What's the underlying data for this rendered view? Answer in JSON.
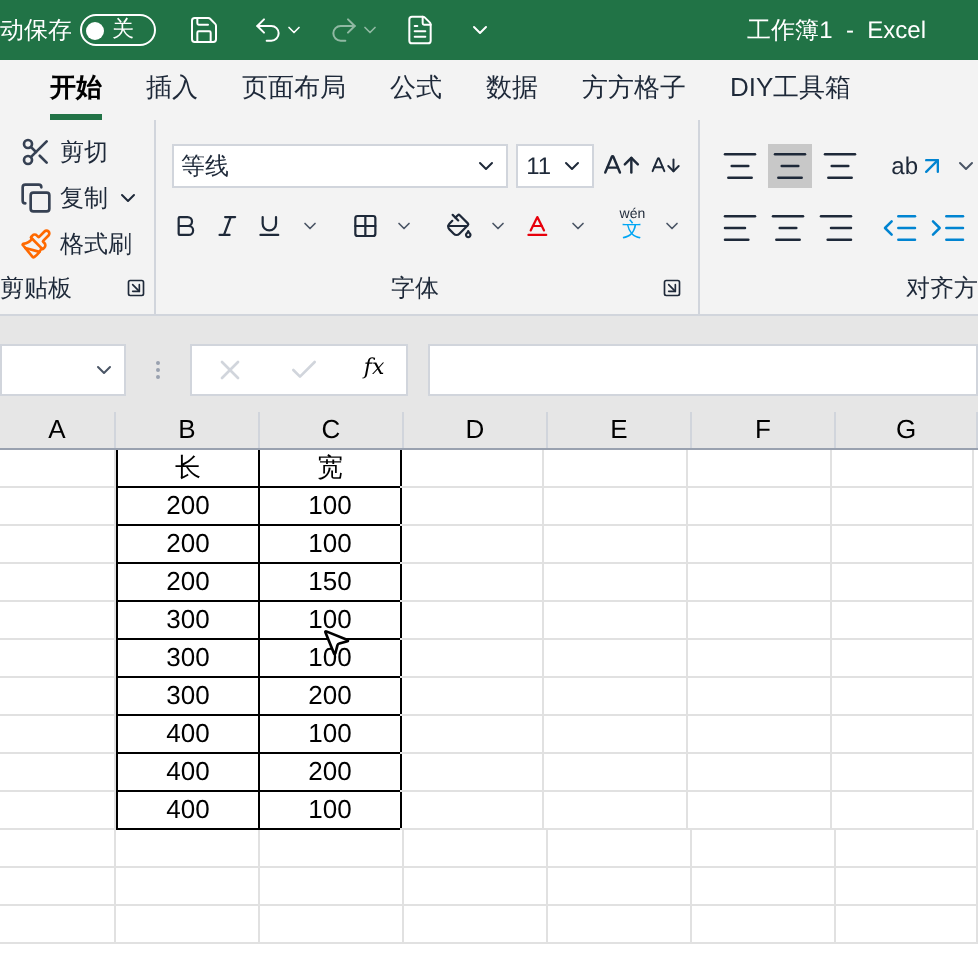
{
  "title_bar": {
    "autosave_label": "动保存",
    "autosave_toggle": {
      "label": "关",
      "on": false
    },
    "title": "工作簿1  -  Excel"
  },
  "tabs": [
    {
      "label": "开始",
      "selected": true
    },
    {
      "label": "插入",
      "selected": false
    },
    {
      "label": "页面布局",
      "selected": false
    },
    {
      "label": "公式",
      "selected": false
    },
    {
      "label": "数据",
      "selected": false
    },
    {
      "label": "方方格子",
      "selected": false
    },
    {
      "label": "DIY工具箱",
      "selected": false
    }
  ],
  "ribbon": {
    "clipboard": {
      "items": [
        "剪切",
        "复制",
        "格式刷"
      ],
      "label": "剪贴板"
    },
    "font": {
      "font_name": "等线",
      "font_size": "11",
      "phonetic": "wén",
      "phonetic_char": "文",
      "label": "字体"
    },
    "alignment": {
      "orientation_label": "ab",
      "label": "对齐方"
    }
  },
  "formula_bar": {
    "function_label": "fx"
  },
  "sheet": {
    "columns": [
      "A",
      "B",
      "C",
      "D",
      "E",
      "F",
      "G"
    ],
    "rows": [
      [
        "",
        "长",
        "宽"
      ],
      [
        "",
        "200",
        "100"
      ],
      [
        "",
        "200",
        "100"
      ],
      [
        "",
        "200",
        "150"
      ],
      [
        "",
        "300",
        "100"
      ],
      [
        "",
        "300",
        "100"
      ],
      [
        "",
        "300",
        "200"
      ],
      [
        "",
        "400",
        "100"
      ],
      [
        "",
        "400",
        "200"
      ],
      [
        "",
        "400",
        "100"
      ]
    ]
  }
}
